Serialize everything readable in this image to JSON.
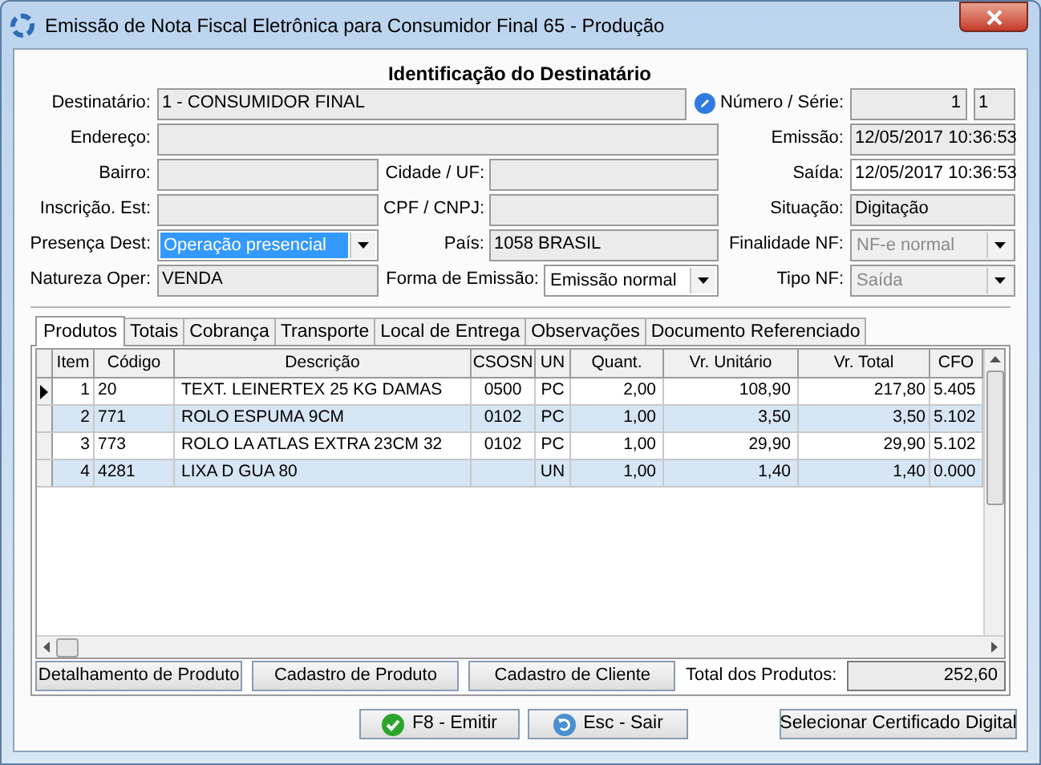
{
  "window": {
    "title": "Emissão de Nota Fiscal Eletrônica para Consumidor Final 65 - Produção"
  },
  "header": {
    "title": "Identificação do Destinatário"
  },
  "form_rows": [
    [
      {
        "label": "Destinatário:",
        "value": "1 - CONSUMIDOR FINAL",
        "kind": "lookup",
        "readonly": true
      },
      {
        "label": "Número / Série:",
        "kind": "pair",
        "values": [
          "1",
          "1"
        ],
        "readonly": true
      }
    ],
    [
      {
        "label": "Endereço:",
        "kind": "text",
        "readonly": true
      },
      {
        "label": "Emissão:",
        "value": "12/05/2017 10:36:53",
        "kind": "text",
        "readonly": true
      }
    ],
    [
      {
        "label": "Bairro:",
        "kind": "text",
        "readonly": true
      },
      {
        "label": "Cidade / UF:",
        "kind": "text",
        "readonly": true
      },
      {
        "label": "Saída:",
        "value": "12/05/2017 10:36:53",
        "kind": "text",
        "readonly": false
      }
    ],
    [
      {
        "label": "Inscrição. Est:",
        "kind": "text",
        "readonly": true
      },
      {
        "label": "CPF / CNPJ:",
        "kind": "text",
        "readonly": true
      },
      {
        "label": "Situação:",
        "value": "Digitação",
        "kind": "text",
        "readonly": true
      }
    ],
    [
      {
        "label": "Presença Dest:",
        "value": "Operação presencial",
        "kind": "select",
        "disabled": false,
        "focused": true
      },
      {
        "label": "País:",
        "value": "1058 BRASIL",
        "kind": "text",
        "readonly": true
      },
      {
        "label": "Finalidade NF:",
        "value": "NF-e normal",
        "kind": "select",
        "disabled": true,
        "focused": false
      }
    ],
    [
      {
        "label": "Natureza Oper:",
        "value": "VENDA",
        "kind": "text",
        "readonly": true
      },
      {
        "label": "Forma de Emissão:",
        "value": "Emissão normal",
        "kind": "select",
        "disabled": false,
        "focused": false
      },
      {
        "label": "Tipo NF:",
        "value": "Saída",
        "kind": "select",
        "disabled": true,
        "focused": false
      }
    ]
  ],
  "tabs": [
    {
      "label": "Produtos",
      "selected": true
    },
    {
      "label": "Totais",
      "selected": false
    },
    {
      "label": "Cobrança",
      "selected": false
    },
    {
      "label": "Transporte",
      "selected": false
    },
    {
      "label": "Local de Entrega",
      "selected": false
    },
    {
      "label": "Observações",
      "selected": false
    },
    {
      "label": "Documento Referenciado",
      "selected": false
    }
  ],
  "products_table": {
    "columns": [
      "Item",
      "Código",
      "Descrição",
      "CSOSN",
      "UN",
      "Quant.",
      "Vr. Unitário",
      "Vr. Total",
      "CFO"
    ],
    "rows": [
      {
        "selected": true,
        "cells": [
          "1",
          "20",
          "TEXT. LEINERTEX 25 KG DAMAS",
          "0500",
          "PC",
          "2,00",
          "108,90",
          "217,80",
          "5.405"
        ]
      },
      {
        "selected": false,
        "cells": [
          "2",
          "771",
          "ROLO ESPUMA 9CM",
          "0102",
          "PC",
          "1,00",
          "3,50",
          "3,50",
          "5.102"
        ]
      },
      {
        "selected": false,
        "cells": [
          "3",
          "773",
          "ROLO LA ATLAS EXTRA 23CM 32",
          "0102",
          "PC",
          "1,00",
          "29,90",
          "29,90",
          "5.102"
        ]
      },
      {
        "selected": false,
        "cells": [
          "4",
          "4281",
          "LIXA D GUA 80",
          "",
          "UN",
          "1,00",
          "1,40",
          "1,40",
          "0.000"
        ]
      }
    ]
  },
  "table_buttons": [
    "Detalhamento de Produto",
    "Cadastro de Produto",
    "Cadastro de Cliente"
  ],
  "total": {
    "label": "Total dos Produtos:",
    "value": "252,60"
  },
  "footer_buttons": [
    {
      "label": "F8 - Emitir",
      "kind": "confirm"
    },
    {
      "label": "Esc - Sair",
      "kind": "exit"
    },
    {
      "label": "Selecionar Certificado Digital",
      "kind": "plain"
    }
  ]
}
